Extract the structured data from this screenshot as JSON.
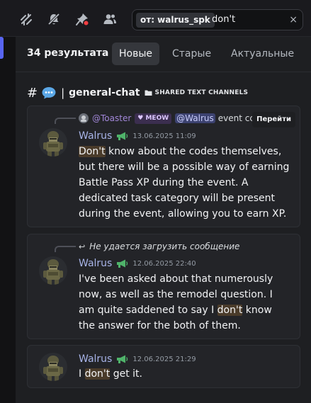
{
  "toolbar": {
    "icons": [
      "threads-icon",
      "mute-bell-icon",
      "pin-icon",
      "members-icon"
    ],
    "search": {
      "filter_chip": "от: walrus_spk",
      "query": "don't",
      "clear": "×"
    }
  },
  "results": {
    "count": "34 результата",
    "tabs": [
      "Новые",
      "Старые",
      "Актуальные"
    ],
    "active_tab": "Новые"
  },
  "channel": {
    "hash": "#",
    "separator": "|",
    "name": "general-chat",
    "category": "SHARED TEXT CHANNELS"
  },
  "messages": [
    {
      "reply": {
        "user": "@Toaster",
        "badge": "MEOW",
        "mention": "@Walrus",
        "text": "event cc",
        "jump": "Перейти"
      },
      "author": "Walrus",
      "timestamp": "13.06.2025 11:09",
      "highlight": "Don't",
      "text_after": " know about the codes themselves, but there will be a possible way of earning Battle Pass XP during the event. A dedicated task category will be present during the event, allowing you to earn XP."
    },
    {
      "reply_failed": "Не удается загрузить сообщение",
      "author": "Walrus",
      "timestamp": "12.06.2025 22:40",
      "text_before": "I've been asked about that numerously now, as well as the remodel question. I am quite saddened to say I ",
      "highlight": "don't",
      "text_after": " know the answer for the both of them."
    },
    {
      "author": "Walrus",
      "timestamp": "12.06.2025 21:29",
      "text_before": "I ",
      "highlight": "don't",
      "text_after": " get it."
    }
  ],
  "colors": {
    "accent": "#5865f2",
    "author": "#a8b4e8",
    "reply_user": "#a287d9",
    "search_highlight": "#4a3b2a"
  }
}
